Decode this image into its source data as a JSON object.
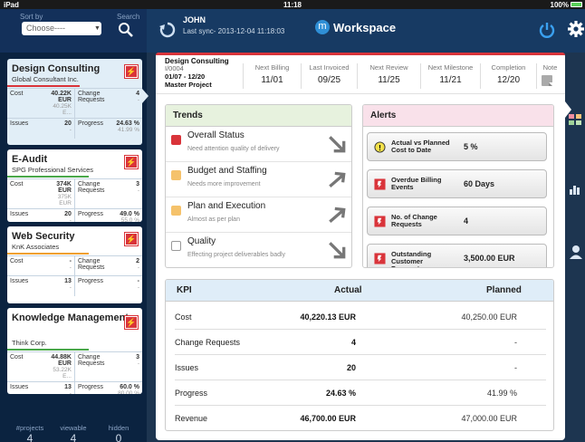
{
  "statusbar": {
    "device": "iPad",
    "time": "11:18",
    "battery": "100%"
  },
  "sidebar": {
    "sort_label": "Sort by",
    "search_label": "Search",
    "choose_placeholder": "Choose----",
    "projects": [
      {
        "title": "Design Consulting",
        "client": "Global Consultant Inc.",
        "flag_color": "#d9343a",
        "bar_color": "#d9343a",
        "cost": "40.22K EUR",
        "cost_sub": "40.25K E...",
        "change_label": "Change Requests",
        "change": "4",
        "change_sub": "-",
        "issues_label": "Issues",
        "issues": "20",
        "issues_sub": "-",
        "progress_label": "Progress",
        "progress": "24.63 %",
        "progress_sub": "41.99 %",
        "cost_label": "Cost"
      },
      {
        "title": "E-Audit",
        "client": "SPG Professional Services",
        "flag_color": "#d9343a",
        "bar_color": "#4aa84a",
        "cost": "374K EUR",
        "cost_sub": "375K EUR",
        "change_label": "Change Requests",
        "change": "3",
        "change_sub": "-",
        "issues_label": "Issues",
        "issues": "20",
        "issues_sub": "-",
        "progress_label": "Progress",
        "progress": "49.0 %",
        "progress_sub": "55.0 %",
        "cost_label": "Cost"
      },
      {
        "title": "Web Security",
        "client": "KnK Associates",
        "flag_color": "#d9343a",
        "bar_color": "#f0a030",
        "cost": "-",
        "cost_sub": "-",
        "change_label": "Change Requests",
        "change": "2",
        "change_sub": "-",
        "issues_label": "Issues",
        "issues": "13",
        "issues_sub": "-",
        "progress_label": "Progress",
        "progress": "-",
        "progress_sub": "-",
        "cost_label": "Cost"
      },
      {
        "title": "Knowledge Management",
        "client": "Think Corp.",
        "flag_color": "#d9343a",
        "bar_color": "#4aa84a",
        "cost": "44.88K EUR",
        "cost_sub": "53.22K E...",
        "change_label": "Change Requests",
        "change": "3",
        "change_sub": "-",
        "issues_label": "Issues",
        "issues": "13",
        "issues_sub": "-",
        "progress_label": "Progress",
        "progress": "60.0 %",
        "progress_sub": "80.00 %",
        "cost_label": "Cost"
      }
    ],
    "stats": {
      "projects_label": "#projects",
      "projects": "4",
      "viewable_label": "viewable",
      "viewable": "4",
      "hidden_label": "hidden",
      "hidden": "0"
    }
  },
  "header": {
    "user": "JOHN",
    "sync": "Last sync- 2013-12-04 11:18:03",
    "app_title": "Workspace",
    "logo_letter": "m"
  },
  "project": {
    "name": "Design Consulting",
    "id": "I/0004",
    "dates": "01/07 - 12/20",
    "type": "Master Project",
    "columns": [
      {
        "label": "Next Billing",
        "value": "11/01"
      },
      {
        "label": "Last Invoiced",
        "value": "09/25"
      },
      {
        "label": "Next Review",
        "value": "11/25"
      },
      {
        "label": "Next Milestone",
        "value": "11/21"
      },
      {
        "label": "Completion",
        "value": "12/20"
      },
      {
        "label": "Note",
        "value": ""
      }
    ]
  },
  "trends": {
    "title": "Trends",
    "items": [
      {
        "title": "Overall Status",
        "sub": "Need attention quality of delivery",
        "color": "#d9343a",
        "arrow": "down"
      },
      {
        "title": "Budget and Staffing",
        "sub": "Needs more improvement",
        "color": "#f5c26b",
        "arrow": "up"
      },
      {
        "title": "Plan and Execution",
        "sub": "Almost as per plan",
        "color": "#f5c26b",
        "arrow": "up"
      },
      {
        "title": "Quality",
        "sub": "Effecting project deliverables badly",
        "color": "#ffffff",
        "arrow": "down"
      }
    ]
  },
  "alerts": {
    "title": "Alerts",
    "items": [
      {
        "label": "Actual vs Planned Cost to Date",
        "value": "5 %",
        "icon": "warning-icon"
      },
      {
        "label": "Overdue Billing Events",
        "value": "60 Days",
        "icon": "flag-icon"
      },
      {
        "label": "No. of Change Requests",
        "value": "4",
        "icon": "flag-icon"
      },
      {
        "label": "Outstanding Customer Payments",
        "value": "3,500.00 EUR",
        "icon": "flag-icon"
      }
    ]
  },
  "kpi": {
    "headers": {
      "kpi": "KPI",
      "actual": "Actual",
      "planned": "Planned"
    },
    "rows": [
      {
        "kpi": "Cost",
        "actual": "40,220.13 EUR",
        "planned": "40,250.00 EUR"
      },
      {
        "kpi": "Change Requests",
        "actual": "4",
        "planned": "-"
      },
      {
        "kpi": "Issues",
        "actual": "20",
        "planned": "-"
      },
      {
        "kpi": "Progress",
        "actual": "24.63 %",
        "planned": "41.99 %"
      },
      {
        "kpi": "Revenue",
        "actual": "46,700.00 EUR",
        "planned": "47,000.00 EUR"
      }
    ]
  }
}
